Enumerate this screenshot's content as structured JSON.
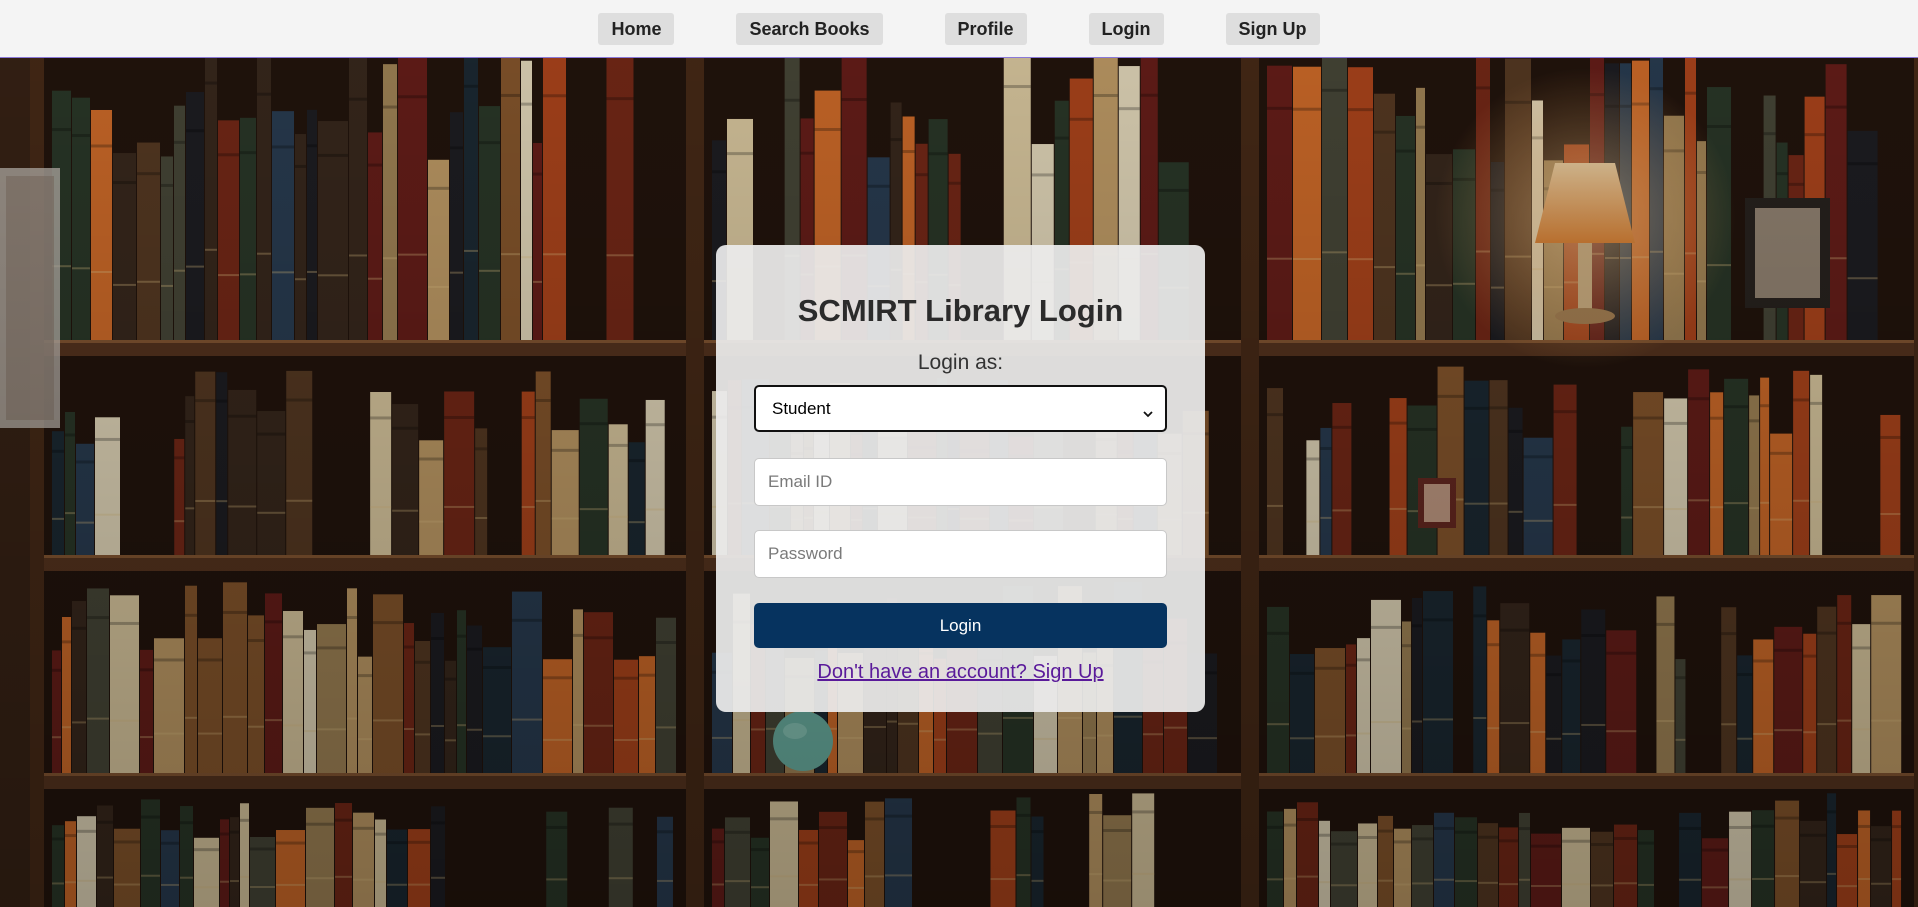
{
  "nav": {
    "items": [
      {
        "label": "Home"
      },
      {
        "label": "Search Books"
      },
      {
        "label": "Profile"
      },
      {
        "label": "Login"
      },
      {
        "label": "Sign Up"
      }
    ]
  },
  "login_card": {
    "title": "SCMIRT Library Login",
    "role_label": "Login as:",
    "role_selected": "Student",
    "email_placeholder": "Email ID",
    "password_placeholder": "Password",
    "submit_label": "Login",
    "signup_link": "Don't have an account? Sign Up"
  },
  "colors": {
    "nav_background": "#f4f4f4",
    "primary_button": "#06335f",
    "link": "#5a1a9a"
  }
}
